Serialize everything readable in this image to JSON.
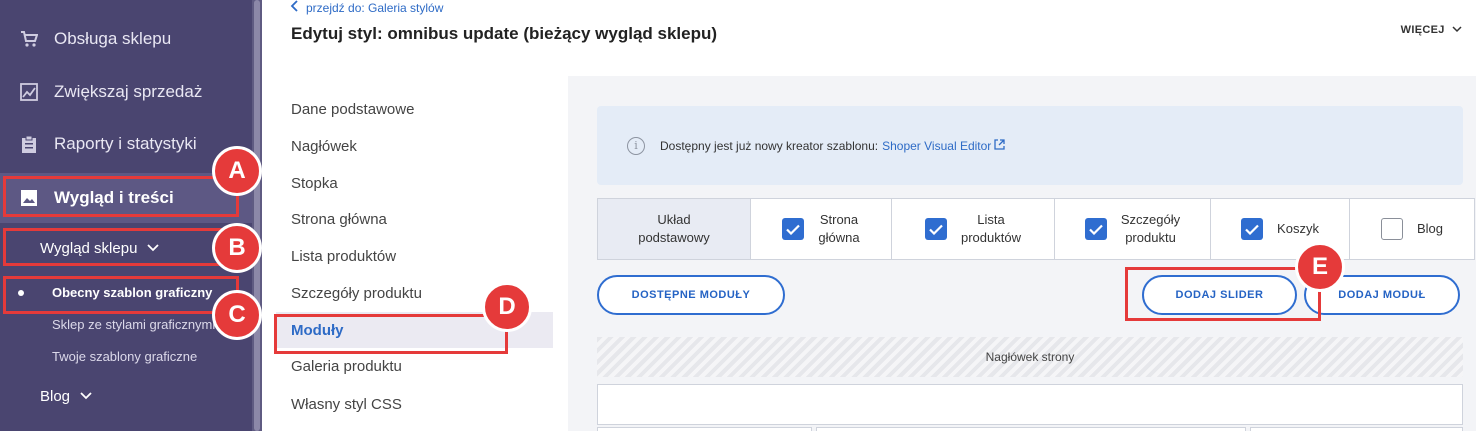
{
  "sidebar": {
    "items": [
      {
        "label": "Obsługa sklepu",
        "icon": "cart-icon"
      },
      {
        "label": "Zwiększaj sprzedaż",
        "icon": "trend-chart-icon"
      },
      {
        "label": "Raporty i statystyki",
        "icon": "clipboard-icon"
      },
      {
        "label": "Wygląd i treści",
        "icon": "image-icon"
      }
    ],
    "submenu_label": "Wygląd sklepu",
    "sub_items": [
      "Obecny szablon graficzny",
      "Sklep ze stylami graficznymi",
      "Twoje szablony graficzne"
    ],
    "blog_label": "Blog"
  },
  "header": {
    "back_link": "przejdź do: Galeria stylów",
    "title": "Edytuj styl: omnibus update (bieżący wygląd sklepu)",
    "more_label": "WIĘCEJ"
  },
  "secondary_nav": [
    "Dane podstawowe",
    "Nagłówek",
    "Stopka",
    "Strona główna",
    "Lista produktów",
    "Szczegóły produktu",
    "Moduły",
    "Galeria produktu",
    "Własny styl CSS"
  ],
  "info": {
    "text": "Dostępny jest już nowy kreator szablonu:",
    "link": "Shoper Visual Editor"
  },
  "layout_tabs": [
    {
      "line1": "Układ",
      "line2": "podstawowy",
      "checkbox": null,
      "selected": true
    },
    {
      "line1": "Strona",
      "line2": "główna",
      "checkbox": true
    },
    {
      "line1": "Lista",
      "line2": "produktów",
      "checkbox": true
    },
    {
      "line1": "Szczegóły",
      "line2": "produktu",
      "checkbox": true
    },
    {
      "line1": "Koszyk",
      "line2": "",
      "checkbox": true
    },
    {
      "line1": "Blog",
      "line2": "",
      "checkbox": false
    }
  ],
  "buttons": {
    "available_modules": "DOSTĘPNE MODUŁY",
    "add_slider": "DODAJ SLIDER",
    "add_module": "DODAJ MODUŁ"
  },
  "page_header_area": "Nagłówek strony",
  "annotations": [
    "A",
    "B",
    "C",
    "D",
    "E"
  ],
  "colors": {
    "sidebar_bg": "#4a4570",
    "accent": "#2f6dd0",
    "annotation": "#e53a3a"
  }
}
